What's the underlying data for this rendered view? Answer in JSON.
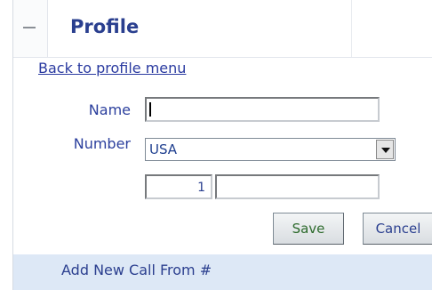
{
  "header": {
    "title": "Profile"
  },
  "nav": {
    "back_link": "Back to profile menu"
  },
  "form": {
    "name_label": "Name",
    "name_value": "",
    "number_label": "Number",
    "country_selected": "USA",
    "country_code": "1",
    "phone_value": ""
  },
  "buttons": {
    "save": "Save",
    "cancel": "Cancel"
  },
  "footer": {
    "add_call_from": "Add New Call From #"
  }
}
